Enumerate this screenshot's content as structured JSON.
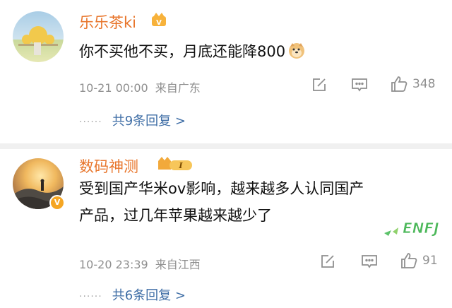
{
  "comments": [
    {
      "username": "乐乐茶ki",
      "text": "你不买他不买，月底还能降800",
      "emoji": "doge-emoji",
      "time": "10-21 00:00",
      "location": "来自广东",
      "likes": "348",
      "replies_label": "共9条回复 >",
      "more": "······"
    },
    {
      "username": "数码神测",
      "badge_text": "I",
      "text_line1": "受到国产华米ov影响，越来越多人认同国产",
      "text_line2": "产品，过几年苹果越来越少了",
      "verified": "V",
      "time": "10-20 23:39",
      "location": "来自江西",
      "likes": "91",
      "replies_label": "共6条回复 >",
      "more": "······"
    }
  ],
  "watermark": "ENFJ",
  "colors": {
    "username": "#e8762c",
    "meta": "#8f8f8f",
    "replies_link": "#3f6ea6",
    "separator": "#f0f0f0"
  }
}
